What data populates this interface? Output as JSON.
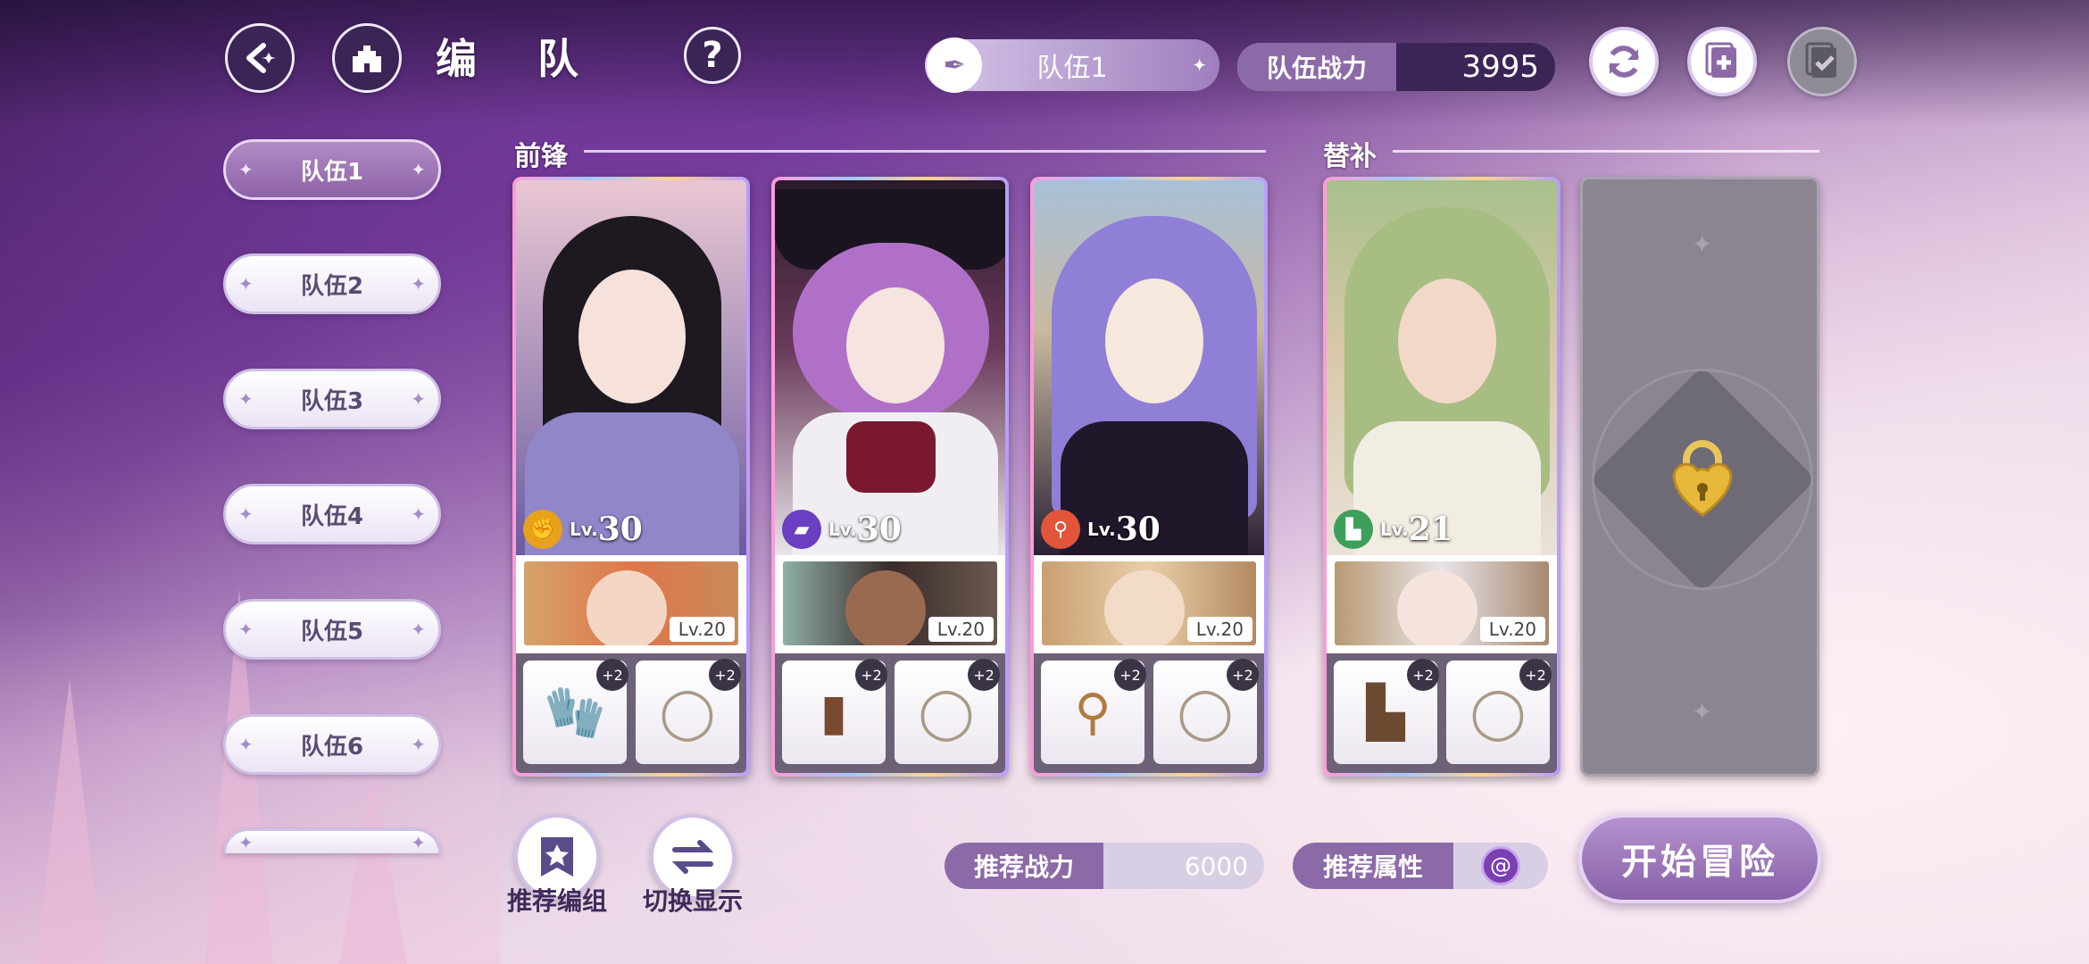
{
  "header": {
    "title": "编 队",
    "team_selector": "队伍1",
    "power_label": "队伍战力",
    "power_value": "3995"
  },
  "sidebar": {
    "items": [
      {
        "label": "队伍1",
        "active": true
      },
      {
        "label": "队伍2",
        "active": false
      },
      {
        "label": "队伍3",
        "active": false
      },
      {
        "label": "队伍4",
        "active": false
      },
      {
        "label": "队伍5",
        "active": false
      },
      {
        "label": "队伍6",
        "active": false
      }
    ]
  },
  "sections": {
    "front": "前锋",
    "sub": "替补"
  },
  "cards": [
    {
      "lv_prefix": "Lv.",
      "lv": "30",
      "element_color": "#e8a11a",
      "element_icon": "fist-icon",
      "support_lv": "Lv.20",
      "gear1": "glove-icon",
      "gear2": "ring-icon",
      "gear1_plus": "+2",
      "gear2_plus": "+2",
      "hair": "#1e1820",
      "bg": "#c9a8b8"
    },
    {
      "lv_prefix": "Lv.",
      "lv": "30",
      "element_color": "#6a3fc2",
      "element_icon": "book-element-icon",
      "support_lv": "Lv.20",
      "gear1": "book-icon",
      "gear2": "ring-icon",
      "gear1_plus": "+2",
      "gear2_plus": "+2",
      "hair": "#b070c8",
      "bg": "#3c2a3a"
    },
    {
      "lv_prefix": "Lv.",
      "lv": "30",
      "element_color": "#e2553a",
      "element_icon": "staff-element-icon",
      "support_lv": "Lv.20",
      "gear1": "scepter-icon",
      "gear2": "ring-icon",
      "gear1_plus": "+2",
      "gear2_plus": "+2",
      "hair": "#8f7fd6",
      "bg": "#9ab3c8"
    },
    {
      "lv_prefix": "Lv.",
      "lv": "21",
      "element_color": "#3ca05a",
      "element_icon": "boot-element-icon",
      "support_lv": "Lv.20",
      "gear1": "boot-icon",
      "gear2": "ring-icon",
      "gear1_plus": "+2",
      "gear2_plus": "+2",
      "hair": "#a8bd82",
      "bg": "#8fb07a"
    }
  ],
  "bottom": {
    "recommend_group": "推荐编组",
    "switch_display": "切换显示",
    "recommend_power_label": "推荐战力",
    "recommend_power_value": "6000",
    "recommend_attr_label": "推荐属性",
    "start_button": "开始冒险"
  },
  "colors": {
    "accent": "#8c6aa8",
    "panel": "#6d6177",
    "locked": "#8a8590"
  }
}
